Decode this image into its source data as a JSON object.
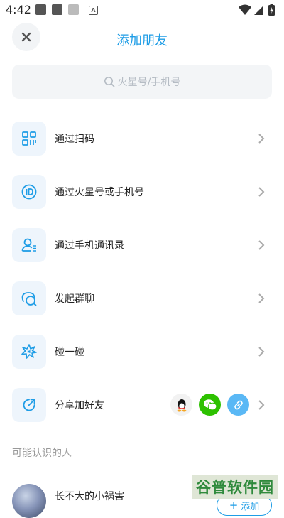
{
  "status_bar": {
    "time": "4:42",
    "notification_letter": "A"
  },
  "header": {
    "title": "添加朋友"
  },
  "search": {
    "placeholder": "火星号/手机号"
  },
  "menu": [
    {
      "label": "通过扫码",
      "icon": "qr-code-icon"
    },
    {
      "label": "通过火星号或手机号",
      "icon": "id-icon"
    },
    {
      "label": "通过手机通讯录",
      "icon": "contacts-icon"
    },
    {
      "label": "发起群聊",
      "icon": "group-chat-icon"
    },
    {
      "label": "碰一碰",
      "icon": "bump-icon"
    },
    {
      "label": "分享加好友",
      "icon": "share-icon"
    }
  ],
  "share_targets": [
    {
      "name": "qq-icon",
      "color": "#f2f2f2"
    },
    {
      "name": "wechat-icon",
      "color": "#2dc100"
    },
    {
      "name": "link-icon",
      "color": "#5ab8f5"
    }
  ],
  "suggestions": {
    "title": "可能认识的人",
    "people": [
      {
        "name": "长不大的小祸害",
        "add_label": "添加"
      }
    ]
  },
  "watermark": {
    "text": "谷普软件园"
  },
  "colors": {
    "accent": "#1f9de6",
    "icon_bg": "#eef5fc"
  }
}
